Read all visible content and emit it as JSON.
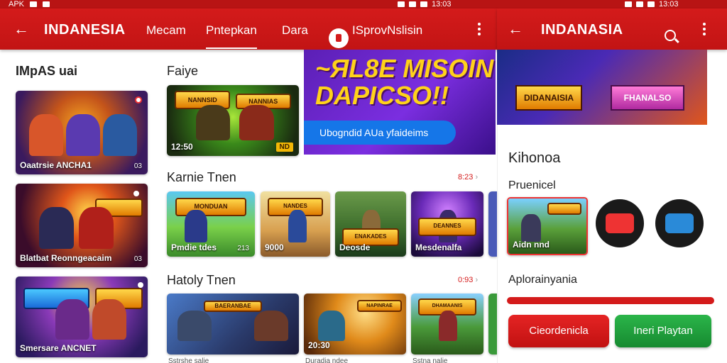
{
  "status_bar": {
    "left_text": "APK",
    "time_left": "13:03",
    "time_right": "13:03"
  },
  "main_appbar": {
    "back_icon": "arrow-left-icon",
    "title": "INDANESIA",
    "tabs": [
      {
        "label": "Mecam"
      },
      {
        "label": "Pntepkan"
      },
      {
        "label": "Dara"
      }
    ],
    "chip_label": "ISprovNslisin",
    "menu_icon": "more-vertical-icon"
  },
  "side_appbar": {
    "back_icon": "arrow-left-icon",
    "title": "INDANASIA",
    "search_icon": "search-icon",
    "menu_icon": "more-vertical-icon"
  },
  "left_column": {
    "title": "IMpAS uai",
    "cards": [
      {
        "caption": "Oaatrsie ANCHA1",
        "badge": "03"
      },
      {
        "caption": "Blatbat Reonngeacaim",
        "badge": "03"
      },
      {
        "caption": "Smersare ANCNET",
        "badge": ""
      }
    ]
  },
  "featured": {
    "section_title": "Faiye",
    "card": {
      "logo": "NANNSID",
      "logo2": "NANNIAS",
      "caption": "12:50",
      "badge": "ND"
    }
  },
  "banner": {
    "headline_line1": "~ЯL8E MISOIN",
    "headline_line2": "DAPICSO!!",
    "cta": "Ubogndid AUa yfaideims"
  },
  "row1": {
    "title": "Karnie Tnen",
    "see_all": "8:23",
    "cards": [
      {
        "logo": "MONDUAN",
        "caption": "Pmdie tdes",
        "badge": "213"
      },
      {
        "logo": "NANDES",
        "caption": "9000",
        "badge": ""
      },
      {
        "logo": "ENAKADES",
        "caption": "Deosde",
        "badge": ""
      },
      {
        "logo": "DEANNES",
        "caption": "Mesdenalfa",
        "badge": ""
      }
    ]
  },
  "row2": {
    "title": "Hatoly Tnen",
    "see_all": "0:93",
    "cards": [
      {
        "logo": "BAERANBAE",
        "caption": "",
        "badge": ""
      },
      {
        "logo": "NAPINRAE",
        "caption": "20:30",
        "badge": ""
      },
      {
        "logo": "DHAMAANIS",
        "caption": "",
        "badge": ""
      }
    ],
    "footer_labels": [
      "Sstrshe salie",
      "Duradia ndee",
      "Sstna nalie"
    ]
  },
  "side_panel": {
    "banner_logo_left": "DIDANAISIA",
    "banner_logo_right": "FHANALSO",
    "heading": "Kihonoa",
    "subheading": "Pruenicel",
    "thumb_caption": "Aidn nnd",
    "circle_icons": [
      "video-icon",
      "share-icon"
    ],
    "progress_label": "Aplorainyania",
    "progress_fraction": 1.0,
    "button_primary": "Cieordenicla",
    "button_secondary": "Ineri Playtan"
  },
  "colors": {
    "brand_red": "#d41b1b",
    "cta_blue": "#1576e8",
    "banner_purple": "#6a25c8",
    "success_green": "#1fa03c"
  }
}
